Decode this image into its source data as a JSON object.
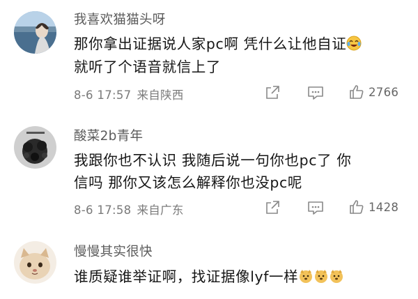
{
  "comments": [
    {
      "username": "我喜欢猫猫头呀",
      "line1": "那你拿出证据说人家pc啊 凭什么让他自证",
      "line2": "就听了个语音就信上了",
      "date": "8-6 17:57",
      "location": "来自陕西",
      "likes": "2766",
      "trailing_emoji": "crying-laughing-emoji"
    },
    {
      "username": "酸菜2b青年",
      "line1": "我跟你也不认识 我随后说一句你也pc了  你",
      "line2": "信吗  那你又该怎么解释你也没pc呢",
      "date": "8-6 17:58",
      "location": "来自广东",
      "likes": "1428"
    },
    {
      "username": "慢慢其实很快",
      "line1": "谁质疑谁举证啊，找证据像lyf一样",
      "trailing_emoji": "dog-emoji-x3"
    }
  ],
  "colors": {
    "username": "#5b5b5b",
    "text": "#161616",
    "meta": "#7a7a7a",
    "icon": "#888888"
  }
}
